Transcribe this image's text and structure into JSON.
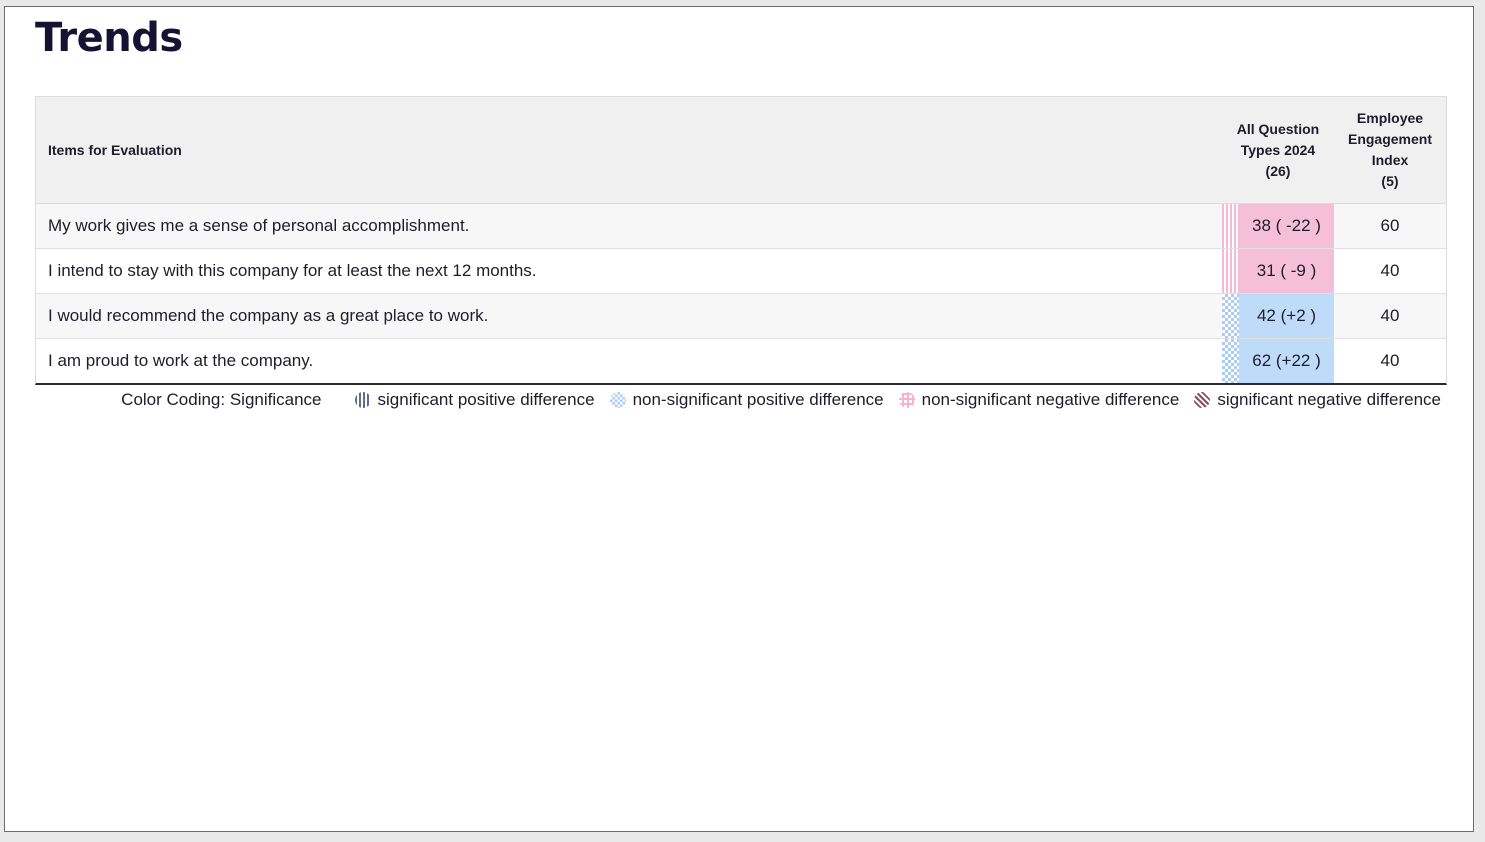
{
  "page": {
    "title": "Trends"
  },
  "table": {
    "headers": {
      "item": "Items for Evaluation",
      "all_question_types": [
        "All Question",
        "Types 2024",
        "(26)"
      ],
      "engagement_index": [
        "Employee",
        "Engagement",
        "Index",
        "(5)"
      ]
    },
    "rows": [
      {
        "item": "My work gives me a sense of personal accomplishment.",
        "all_question_types": "38 ( -22 )",
        "engagement_index": "60",
        "significance": "non-significant negative difference",
        "cell_color": "#f6bfd8"
      },
      {
        "item": "I intend to stay with this company for at least the next 12 months.",
        "all_question_types": "31 ( -9 )",
        "engagement_index": "40",
        "significance": "non-significant negative difference",
        "cell_color": "#f6bfd8"
      },
      {
        "item": "I would recommend the company as a great place to work.",
        "all_question_types": "42 (+2 )",
        "engagement_index": "40",
        "significance": "non-significant positive difference",
        "cell_color": "#bfdbfa"
      },
      {
        "item": "I am proud to work at the company.",
        "all_question_types": "62 (+22 )",
        "engagement_index": "40",
        "significance": "non-significant positive difference",
        "cell_color": "#bfdbfa"
      }
    ]
  },
  "legend": {
    "title": "Color Coding: Significance",
    "items": [
      {
        "label": "significant positive difference",
        "icon": "vertical-stripes-icon",
        "color": "#5a6f95"
      },
      {
        "label": "non-significant positive difference",
        "icon": "checker-icon",
        "color": "#a9ccf6"
      },
      {
        "label": "non-significant negative difference",
        "icon": "grid-icon",
        "color": "#f5b3cf"
      },
      {
        "label": "significant negative difference",
        "icon": "diagonal-stripes-icon",
        "color": "#8e4b66"
      }
    ]
  }
}
